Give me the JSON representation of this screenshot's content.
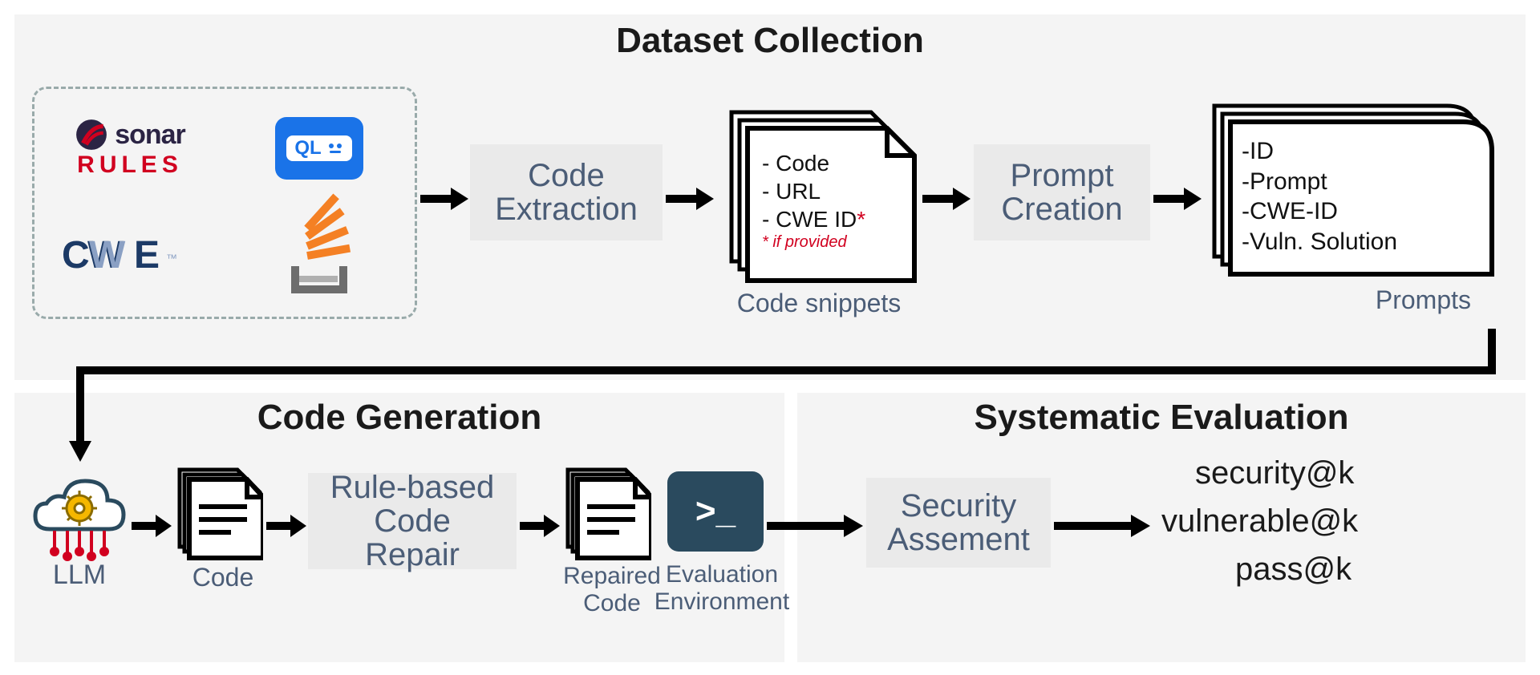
{
  "panels": {
    "dataset": {
      "title": "Dataset Collection"
    },
    "codegen": {
      "title": "Code Generation"
    },
    "eval": {
      "title": "Systematic Evaluation"
    }
  },
  "sources": {
    "sonar_word": "sonar",
    "sonar_rules": "RULES",
    "ql_label": "QL",
    "cwe_label": "CWE",
    "stackoverflow_label": "Stack Overflow"
  },
  "steps": {
    "code_extraction": "Code\nExtraction",
    "prompt_creation": "Prompt\nCreation",
    "rule_repair": "Rule-based\nCode Repair",
    "security_assessment": "Security\nAssement"
  },
  "snippets": {
    "line1": "- Code",
    "line2": "- URL",
    "line3_prefix": "- CWE ID",
    "line3_star": "*",
    "note": "* if provided",
    "caption": "Code snippets"
  },
  "prompts_doc": {
    "line1": "-ID",
    "line2": "-Prompt",
    "line3": "-CWE-ID",
    "line4": "-Vuln. Solution",
    "caption": "Prompts"
  },
  "codegen_labels": {
    "llm": "LLM",
    "code": "Code",
    "repaired": "Repaired\nCode",
    "evalenv": "Evaluation\nEnvironment"
  },
  "metrics": {
    "m1": "security@k",
    "m2": "vulnerable@k",
    "m3": "pass@k"
  }
}
